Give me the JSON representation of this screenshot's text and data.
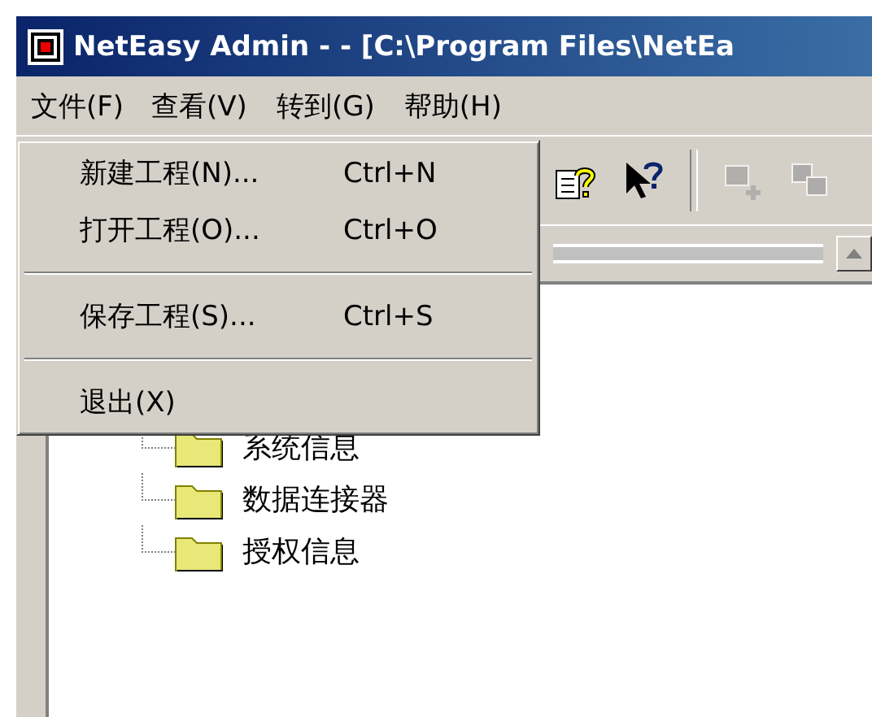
{
  "window": {
    "title": "NetEasy Admin -  - [C:\\Program Files\\NetEa"
  },
  "menubar": [
    {
      "label": "文件(F)",
      "selected": true
    },
    {
      "label": "查看(V)",
      "selected": false
    },
    {
      "label": "转到(G)",
      "selected": false
    },
    {
      "label": "帮助(H)",
      "selected": false
    }
  ],
  "dropdown": [
    {
      "kind": "item",
      "label": "新建工程(N)...",
      "shortcut": "Ctrl+N"
    },
    {
      "kind": "item",
      "label": "打开工程(O)...",
      "shortcut": "Ctrl+O"
    },
    {
      "kind": "separator"
    },
    {
      "kind": "item",
      "label": "保存工程(S)...",
      "shortcut": "Ctrl+S"
    },
    {
      "kind": "separator"
    },
    {
      "kind": "item",
      "label": "退出(X)"
    }
  ],
  "toolbar": [
    {
      "kind": "help-topic",
      "disabled": false
    },
    {
      "kind": "whats-this",
      "disabled": false
    },
    {
      "kind": "separator"
    },
    {
      "kind": "add",
      "disabled": true
    },
    {
      "kind": "copy",
      "disabled": true
    }
  ],
  "tree": {
    "children": [
      {
        "label": "系统信息"
      },
      {
        "label": "数据连接器"
      },
      {
        "label": "授权信息"
      }
    ]
  }
}
